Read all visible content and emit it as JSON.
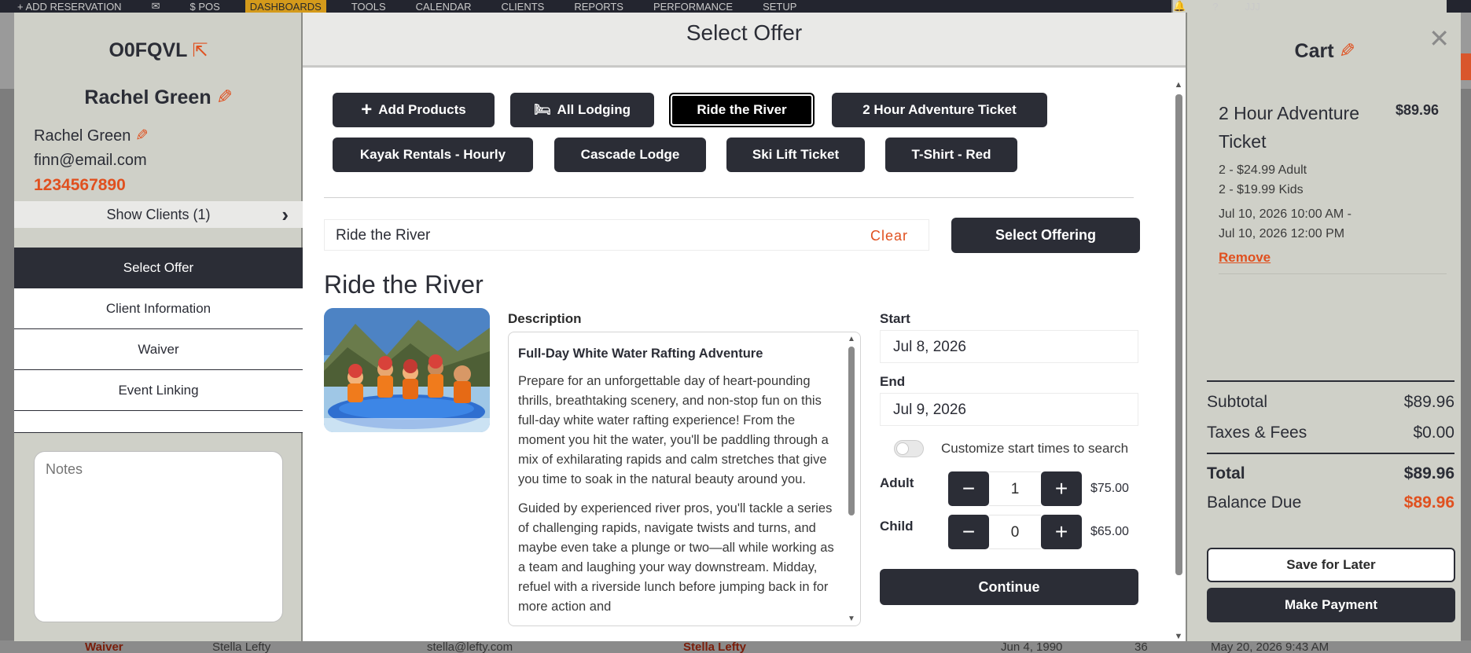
{
  "topnav": {
    "items": [
      "+ ADD RESERVATION",
      "✉",
      "$ POS",
      "DASHBOARDS",
      "TOOLS",
      "CALENDAR",
      "CLIENTS",
      "REPORTS",
      "PERFORMANCE",
      "SETUP"
    ],
    "user": "JJJ"
  },
  "background_row": {
    "type": "Waiver",
    "client": "Stella Lefty",
    "email": "stella@lefty.com",
    "name": "Stella Lefty",
    "dob": "Jun 4, 1990",
    "age": "36",
    "date": "May 20, 2026 9:43 AM"
  },
  "left": {
    "reservation_code": "O0FQVL",
    "client_name_heading": "Rachel Green",
    "contact": {
      "name": "Rachel Green",
      "email": "finn@email.com",
      "phone": "1234567890"
    },
    "show_clients": "Show Clients (1)",
    "menu": [
      "Select Offer",
      "Client Information",
      "Waiver",
      "Event Linking"
    ],
    "notes_placeholder": "Notes"
  },
  "center": {
    "title": "Select Offer",
    "chips": [
      "Add Products",
      "All Lodging",
      "Ride the River",
      "2 Hour Adventure Ticket",
      "Kayak Rentals - Hourly",
      "Cascade Lodge",
      "Ski Lift Ticket",
      "T-Shirt - Red"
    ],
    "selected_chip": "Ride the River",
    "search_value": "Ride the River",
    "clear_label": "Clear",
    "select_offering_label": "Select Offering",
    "offer_title": "Ride the River",
    "description_label": "Description",
    "description_heading": "Full-Day White Water Rafting Adventure",
    "description_p1": "Prepare for an unforgettable day of heart-pounding thrills, breathtaking scenery, and non-stop fun on this full-day white water rafting experience! From the moment you hit the water, you'll be paddling through a mix of exhilarating rapids and calm stretches that give you time to soak in the natural beauty around you.",
    "description_p2": "Guided by experienced river pros, you'll tackle a series of challenging rapids, navigate twists and turns, and maybe even take a plunge or two—all while working as a team and laughing your way downstream. Midday, refuel with a riverside lunch before jumping back in for more action and",
    "start_label": "Start",
    "start_value": "Jul 8, 2026",
    "end_label": "End",
    "end_value": "Jul 9, 2026",
    "customize_label": "Customize start times to search",
    "customize_on": false,
    "adult_label": "Adult",
    "adult_qty": "1",
    "adult_price": "$75.00",
    "child_label": "Child",
    "child_qty": "0",
    "child_price": "$65.00",
    "continue_label": "Continue"
  },
  "cart": {
    "title": "Cart",
    "item_name": "2 Hour Adventure Ticket",
    "item_price": "$89.96",
    "item_lines": [
      "2 - $24.99 Adult",
      "2 - $19.99 Kids"
    ],
    "item_dates": [
      "Jul 10, 2026 10:00 AM -",
      "Jul 10, 2026 12:00 PM"
    ],
    "remove_label": "Remove",
    "subtotal_label": "Subtotal",
    "subtotal": "$89.96",
    "taxes_label": "Taxes & Fees",
    "taxes": "$0.00",
    "total_label": "Total",
    "total": "$89.96",
    "balance_label": "Balance Due",
    "balance": "$89.96",
    "save_later_label": "Save for Later",
    "make_payment_label": "Make Payment"
  },
  "colors": {
    "accent": "#e0501f",
    "dark": "#2b2d36",
    "panel": "#cfd0c8"
  }
}
